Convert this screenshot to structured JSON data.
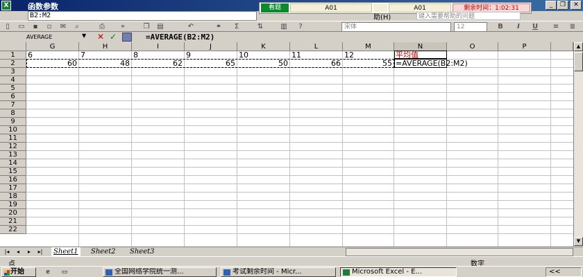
{
  "window": {
    "title": "函数参数",
    "app_icon": "X"
  },
  "exam": {
    "view_label": "看题",
    "question_a": "A01",
    "question_b": "A01",
    "remaining_label": "剩余时间：1:02:31"
  },
  "dialog_range": "B2:M2",
  "help": {
    "label": "助(H)",
    "input": "键入需要帮助的问题"
  },
  "toolbar": {
    "font_name": "宋体",
    "font_size": "12",
    "bold": "B",
    "italic": "I",
    "underline": "U"
  },
  "formula_bar": {
    "name_box": "AVERAGE",
    "formula": "=AVERAGE(B2:M2)"
  },
  "grid": {
    "columns": [
      "G",
      "H",
      "I",
      "J",
      "K",
      "L",
      "M",
      "N",
      "O",
      "P"
    ],
    "rows": [
      "1",
      "2",
      "3",
      "4",
      "5",
      "6",
      "7",
      "8",
      "9",
      "10",
      "11",
      "12",
      "13",
      "14",
      "15",
      "16",
      "17",
      "18",
      "19",
      "20",
      "21",
      "22"
    ],
    "row1": [
      "6",
      "7",
      "8",
      "9",
      "10",
      "11",
      "12",
      "平均值"
    ],
    "row2": [
      "60",
      "48",
      "62",
      "65",
      "50",
      "66",
      "55",
      "=AVERAGE(B2:M2)"
    ]
  },
  "sheets": [
    "Sheet1",
    "Sheet2",
    "Sheet3"
  ],
  "status": {
    "left": "点",
    "right": "数字"
  },
  "taskbar": {
    "start": "开始",
    "tasks": [
      "全国网络学院统一测...",
      "考试剩余时间 - Micr...",
      "Microsoft Excel - E..."
    ],
    "tray": "<<"
  },
  "colors": {
    "accent": "#0a246a",
    "exam_green": "#0a8a2a",
    "red_text": "#c00000"
  }
}
